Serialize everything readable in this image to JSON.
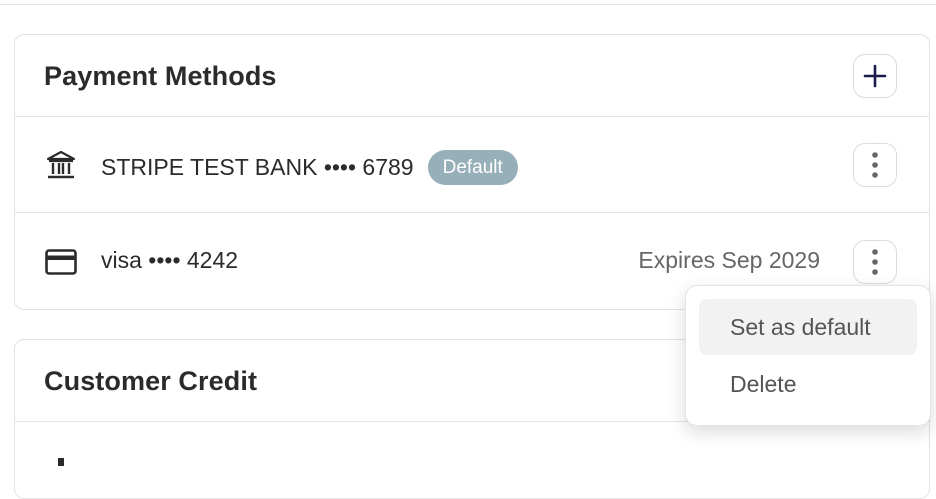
{
  "payment_methods": {
    "title": "Payment Methods",
    "add_icon": "plus-icon",
    "items": [
      {
        "icon": "bank-icon",
        "label": "STRIPE TEST BANK •••• 6789",
        "badge": "Default",
        "more_icon": "more-vertical-icon"
      },
      {
        "icon": "credit-card-icon",
        "label": "visa •••• 4242",
        "expires": "Expires Sep 2029",
        "more_icon": "more-vertical-icon"
      }
    ]
  },
  "menu": {
    "items": [
      "Set as default",
      "Delete"
    ]
  },
  "customer_credit": {
    "title": "Customer Credit"
  },
  "colors": {
    "badge_bg": "#97afb9",
    "plus_icon": "#1a1a4e"
  }
}
